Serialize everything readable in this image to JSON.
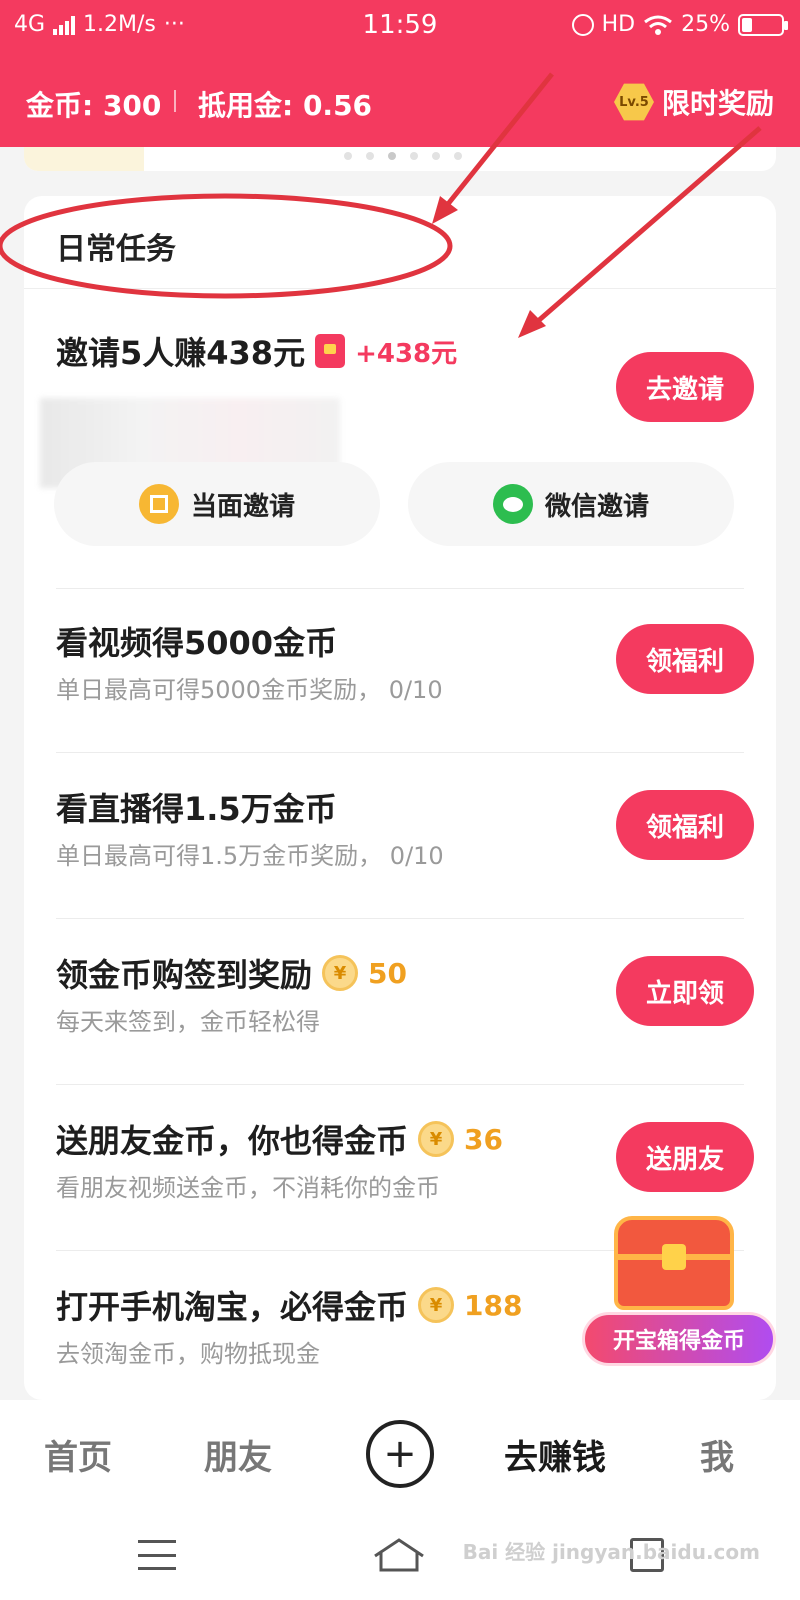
{
  "status_bar": {
    "network": "4G",
    "speed": "1.2M/s",
    "more": "···",
    "time": "11:59",
    "hd": "HD",
    "battery": "25%"
  },
  "header": {
    "coins_label": "金币: 300",
    "deduction_label": "抵用金: 0.56",
    "level_badge": "Lv.5",
    "reward_label": "限时奖励"
  },
  "section": {
    "title": "日常任务"
  },
  "invite_task": {
    "title": "邀请5人赚438元",
    "bonus": "+438元",
    "button": "去邀请",
    "face_invite": "当面邀请",
    "wechat_invite": "微信邀请"
  },
  "tasks": [
    {
      "title": "看视频得5000金币",
      "subtitle": "单日最高可得5000金币奖励， 0/10",
      "button": "领福利"
    },
    {
      "title": "看直播得1.5万金币",
      "subtitle": "单日最高可得1.5万金币奖励， 0/10",
      "button": "领福利"
    },
    {
      "title": "领金币购签到奖励",
      "coin_amount": "50",
      "subtitle": "每天来签到，金币轻松得",
      "button": "立即领"
    },
    {
      "title": "送朋友金币，你也得金币",
      "coin_amount": "36",
      "subtitle": "看朋友视频送金币，不消耗你的金币",
      "button": "送朋友"
    },
    {
      "title": "打开手机淘宝，必得金币",
      "coin_amount": "188",
      "subtitle": "去领淘金币，购物抵现金"
    }
  ],
  "coin_symbol": "¥",
  "floating": {
    "treasure_label": "开宝箱得金币"
  },
  "bottom_nav": {
    "items": [
      "首页",
      "朋友",
      "去赚钱",
      "我"
    ],
    "plus": "+"
  },
  "watermark": "Bai 经验 jingyan.baidu.com",
  "colors": {
    "brand": "#f43a5f",
    "coin": "#f0a020",
    "annotation": "#e0343f"
  }
}
